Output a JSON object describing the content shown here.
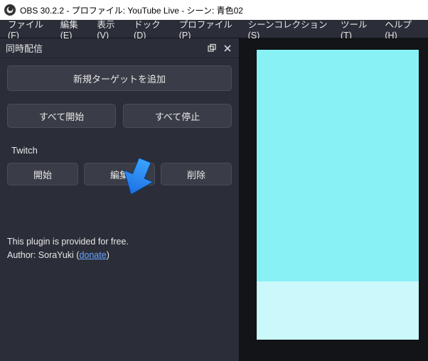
{
  "window": {
    "title": "OBS 30.2.2 - プロファイル: YouTube Live - シーン: 青色02"
  },
  "menu": {
    "file": "ファイル(F)",
    "edit": "編集(E)",
    "view": "表示(V)",
    "dock": "ドック(D)",
    "profile": "プロファイル(P)",
    "scene_collection": "シーンコレクション(S)",
    "tools": "ツール(T)",
    "help": "ヘルプ(H)"
  },
  "dock": {
    "title": "同時配信",
    "add_target": "新規ターゲットを追加",
    "start_all": "すべて開始",
    "stop_all": "すべて停止",
    "targets": [
      {
        "name": "Twitch",
        "start": "開始",
        "edit": "編集",
        "delete": "削除"
      }
    ],
    "footer_line1": "This plugin is provided for free.",
    "footer_author_prefix": "Author: SoraYuki (",
    "footer_link": "donate",
    "footer_author_suffix": ")"
  },
  "colors": {
    "preview_top": "#88f1f6",
    "preview_bottom": "#cbf9fb"
  },
  "annotation": {
    "arrow_target": "edit-button"
  }
}
